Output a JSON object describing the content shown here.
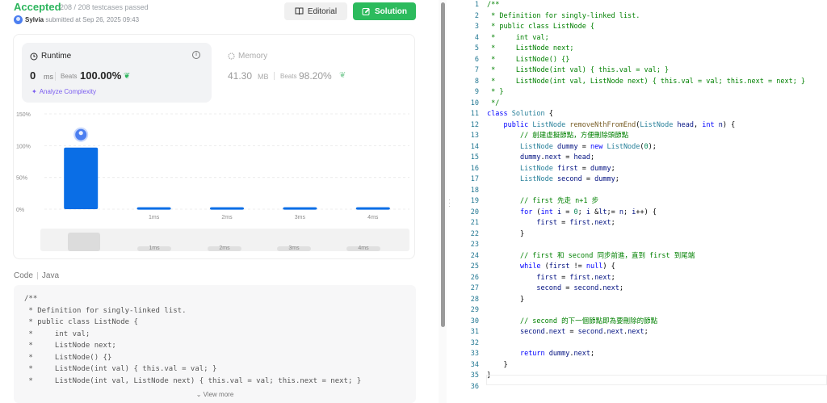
{
  "header": {
    "status": "Accepted",
    "testcases": "208 / 208 testcases passed",
    "user": "Sylvia",
    "submitted": "submitted at Sep 26, 2025 09:43",
    "editorial_label": "Editorial",
    "solution_label": "Solution"
  },
  "runtime": {
    "label": "Runtime",
    "value": "0",
    "unit": "ms",
    "beats_label": "Beats",
    "beats_pct": "100.00%",
    "analyze_label": "Analyze Complexity"
  },
  "memory": {
    "label": "Memory",
    "value": "41.30",
    "unit": "MB",
    "beats_label": "Beats",
    "beats_pct": "98.20%"
  },
  "chart_data": {
    "type": "bar",
    "categories": [
      "0ms",
      "1ms",
      "2ms",
      "3ms",
      "4ms"
    ],
    "tick_labels": [
      "",
      "1ms",
      "2ms",
      "3ms",
      "4ms"
    ],
    "values": [
      97,
      3,
      3,
      3,
      3
    ],
    "yticks": [
      "150%",
      "100%",
      "50%",
      "0%"
    ],
    "ylim": [
      0,
      150
    ],
    "bar_color": "#0a6ee6",
    "grid": true
  },
  "minimap": {
    "ticks": [
      "1ms",
      "2ms",
      "3ms",
      "4ms"
    ]
  },
  "code_panel": {
    "label": "Code",
    "language": "Java",
    "lines": [
      "/**",
      " * Definition for singly-linked list.",
      " * public class ListNode {",
      " *     int val;",
      " *     ListNode next;",
      " *     ListNode() {}",
      " *     ListNode(int val) { this.val = val; }",
      " *     ListNode(int val, ListNode next) { this.val = val; this.next = next; }"
    ],
    "view_more": "View more"
  },
  "editor": {
    "lines": [
      "/**",
      " * Definition for singly-linked list.",
      " * public class ListNode {",
      " *     int val;",
      " *     ListNode next;",
      " *     ListNode() {}",
      " *     ListNode(int val) { this.val = val; }",
      " *     ListNode(int val, ListNode next) { this.val = val; this.next = next; }",
      " * }",
      " */",
      "class Solution {",
      "    public ListNode removeNthFromEnd(ListNode head, int n) {",
      "        // 創建虛擬節點，方便刪除頭節點",
      "        ListNode dummy = new ListNode(0);",
      "        dummy.next = head;",
      "        ListNode first = dummy;",
      "        ListNode second = dummy;",
      "",
      "        // first 先走 n+1 步",
      "        for (int i = 0; i <= n; i++) {",
      "            first = first.next;",
      "        }",
      "",
      "        // first 和 second 同步前進，直到 first 到尾端",
      "        while (first != null) {",
      "            first = first.next;",
      "            second = second.next;",
      "        }",
      "",
      "        // second 的下一個節點即為要刪除的節點",
      "        second.next = second.next.next;",
      "",
      "        return dummy.next;",
      "    }",
      "}",
      ""
    ]
  },
  "colors": {
    "accepted": "#2db55d",
    "solution_button": "#2cbb5d",
    "bar": "#0a6ee6",
    "comment": "#008000",
    "keyword": "#0000ff",
    "type": "#267f99",
    "method": "#795e26",
    "param": "#001080",
    "number": "#098658",
    "line_number": "#237893"
  }
}
